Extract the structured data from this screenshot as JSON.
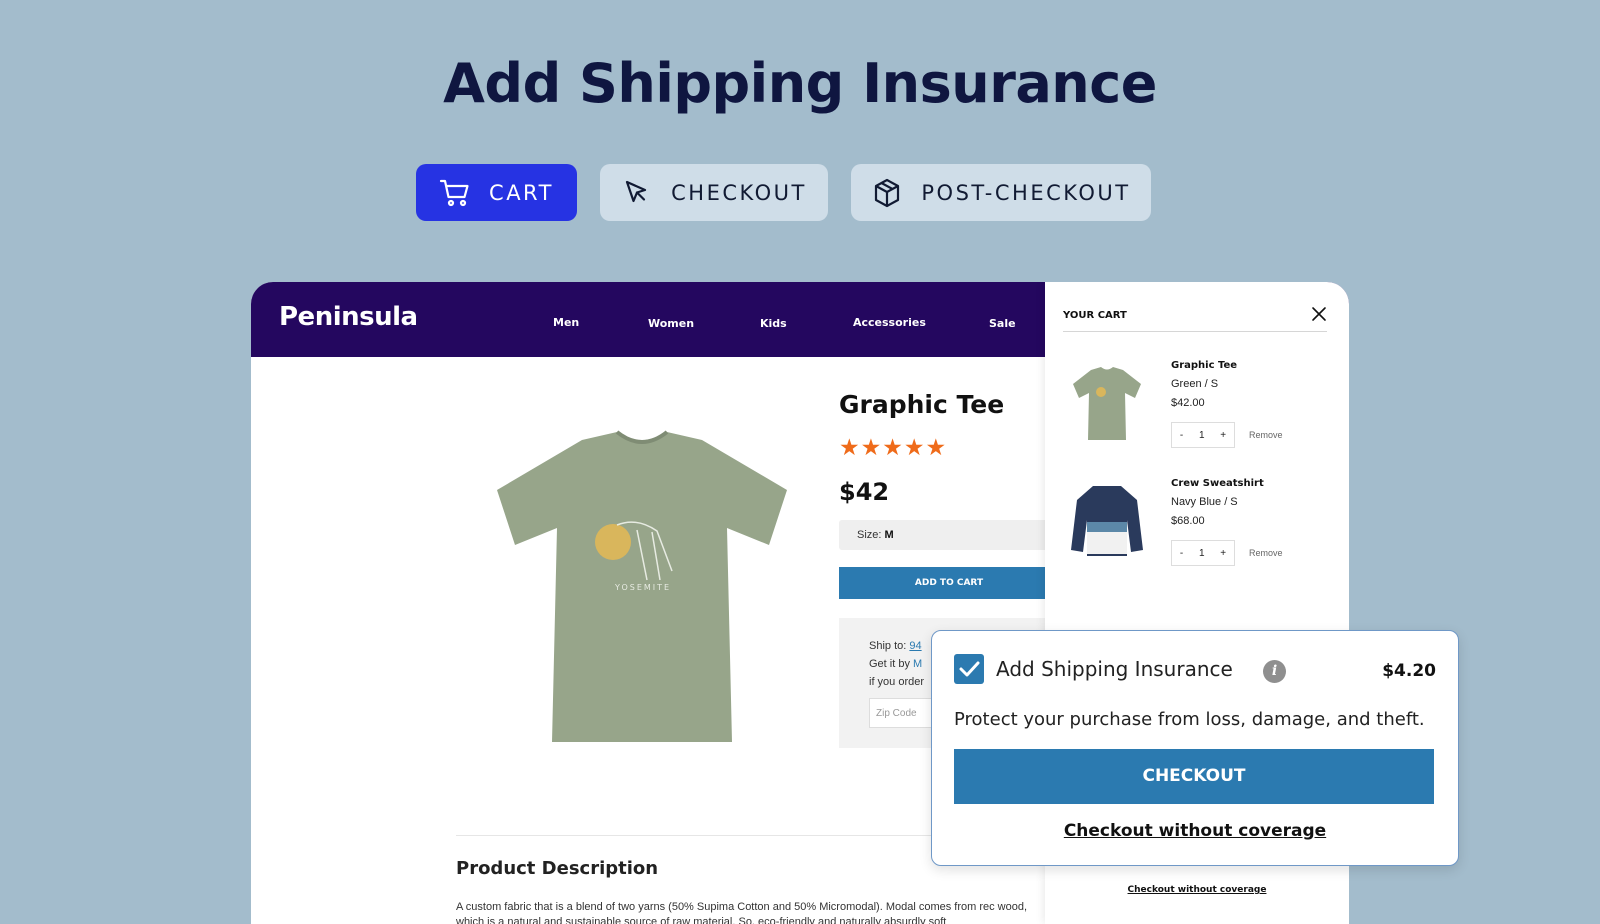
{
  "headline": "Add Shipping Insurance",
  "tabs": [
    {
      "label": "CART",
      "icon": "cart-icon",
      "active": true
    },
    {
      "label": "CHECKOUT",
      "icon": "cursor-icon",
      "active": false
    },
    {
      "label": "POST-CHECKOUT",
      "icon": "package-icon",
      "active": false
    }
  ],
  "store": {
    "logo": "Peninsula",
    "nav": [
      "Men",
      "Women",
      "Kids",
      "Accessories",
      "Sale"
    ]
  },
  "product": {
    "title": "Graphic Tee",
    "rating": 5,
    "stars": "★★★★★",
    "price": "$42",
    "size_label": "Size:",
    "size_value": "M",
    "add_to_cart": "ADD TO CART",
    "ship_to_label": "Ship to:",
    "ship_to_value": "94",
    "get_it_by_label": "Get it by",
    "get_it_by_value": "M",
    "if_you_order": "if you order",
    "zip_placeholder": "Zip Code",
    "description_title": "Product Description",
    "description_text": "A custom fabric that is a blend of two yarns (50% Supima Cotton and 50% Micromodal). Modal comes from rec wood, which is a natural and sustainable source of raw material. So, eco-friendly and naturally absurdly soft"
  },
  "cart": {
    "title": "YOUR CART",
    "items": [
      {
        "name": "Graphic Tee",
        "variant": "Green / S",
        "price": "$42.00",
        "qty": "1",
        "minus": "-",
        "plus": "+",
        "remove": "Remove"
      },
      {
        "name": "Crew Sweatshirt",
        "variant": "Navy Blue / S",
        "price": "$68.00",
        "qty": "1",
        "minus": "-",
        "plus": "+",
        "remove": "Remove"
      }
    ],
    "bottom_link": "Checkout without coverage"
  },
  "insurance": {
    "checked": true,
    "title": "Add Shipping Insurance",
    "info": "i",
    "price": "$4.20",
    "description": "Protect your purchase from loss, damage, and theft.",
    "checkout": "CHECKOUT",
    "without": "Checkout without coverage"
  },
  "colors": {
    "background": "#a3bccc",
    "accent": "#2633e3",
    "navbar": "#24075f",
    "button": "#2b7ab0",
    "stars": "#ef6b1a"
  }
}
